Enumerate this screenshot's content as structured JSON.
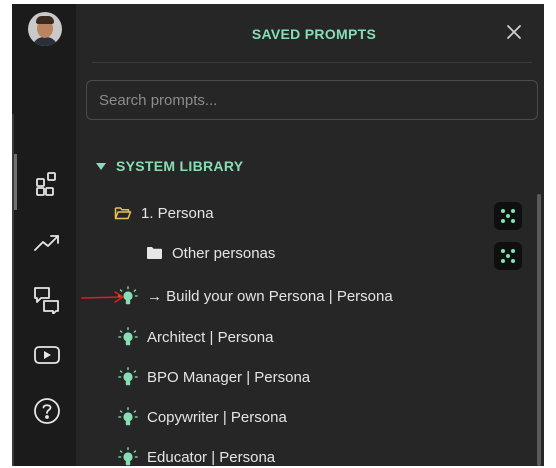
{
  "panel": {
    "title": "SAVED PROMPTS",
    "search_placeholder": "Search prompts...",
    "section_label": "SYSTEM LIBRARY"
  },
  "tree": {
    "folder": "1. Persona",
    "subfolder": "Other personas",
    "prompts": [
      "→ Build your own Persona | Persona",
      "Architect | Persona",
      "BPO Manager | Persona",
      "Copywriter | Persona",
      "Educator | Persona"
    ]
  },
  "icons": {
    "rail": [
      "apps-icon",
      "trending-icon",
      "chat-icon",
      "video-icon",
      "help-icon"
    ],
    "prompt": "lightbulb-icon",
    "folder": "folder-icon",
    "close": "close-icon"
  },
  "colors": {
    "accent": "#86dfb4",
    "background": "#262626",
    "rail": "#1b1b1b",
    "annotation": "#e01e1e"
  }
}
